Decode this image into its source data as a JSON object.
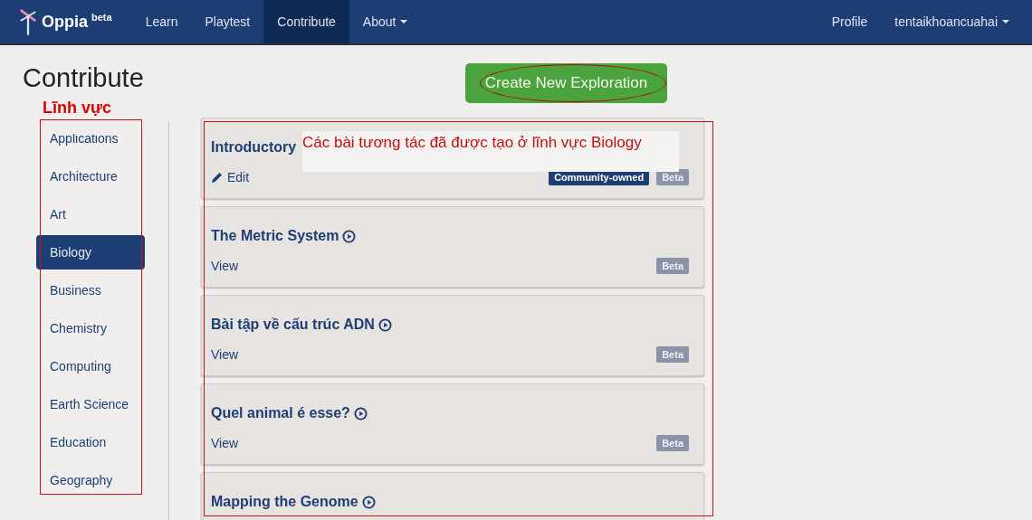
{
  "nav": {
    "brand": "Oppia",
    "brand_tag": "beta",
    "items": [
      {
        "label": "Learn",
        "selected": false,
        "dropdown": false
      },
      {
        "label": "Playtest",
        "selected": false,
        "dropdown": false
      },
      {
        "label": "Contribute",
        "selected": true,
        "dropdown": false
      },
      {
        "label": "About",
        "selected": false,
        "dropdown": true
      }
    ],
    "right_items": [
      {
        "label": "Profile",
        "dropdown": false
      },
      {
        "label": "tentaikhoancuahai",
        "dropdown": true
      }
    ]
  },
  "page_title": "Contribute",
  "create_button": "Create New Exploration",
  "annotations": {
    "sidebar_label": "Lĩnh vực",
    "note": "Các bài tương tác đã được tạo ở lĩnh vực Biology"
  },
  "categories": [
    {
      "label": "Applications",
      "selected": false
    },
    {
      "label": "Architecture",
      "selected": false
    },
    {
      "label": "Art",
      "selected": false
    },
    {
      "label": "Biology",
      "selected": true
    },
    {
      "label": "Business",
      "selected": false
    },
    {
      "label": "Chemistry",
      "selected": false
    },
    {
      "label": "Computing",
      "selected": false
    },
    {
      "label": "Earth Science",
      "selected": false
    },
    {
      "label": "Education",
      "selected": false
    },
    {
      "label": "Geography",
      "selected": false
    }
  ],
  "explorations": [
    {
      "title": "Introductory",
      "kind": "editable",
      "action": "Edit",
      "badges": [
        {
          "label": "Community-owned",
          "kind": "owner"
        },
        {
          "label": "Beta",
          "kind": "status"
        }
      ]
    },
    {
      "title": "The Metric System",
      "kind": "viewable",
      "action": "View",
      "badges": [
        {
          "label": "Beta",
          "kind": "status"
        }
      ]
    },
    {
      "title": "Bài tập về cấu trúc ADN",
      "kind": "viewable",
      "action": "View",
      "badges": [
        {
          "label": "Beta",
          "kind": "status"
        }
      ]
    },
    {
      "title": "Quel animal é esse?",
      "kind": "viewable",
      "action": "View",
      "badges": [
        {
          "label": "Beta",
          "kind": "status"
        }
      ]
    },
    {
      "title": "Mapping the Genome",
      "kind": "viewable"
    }
  ]
}
